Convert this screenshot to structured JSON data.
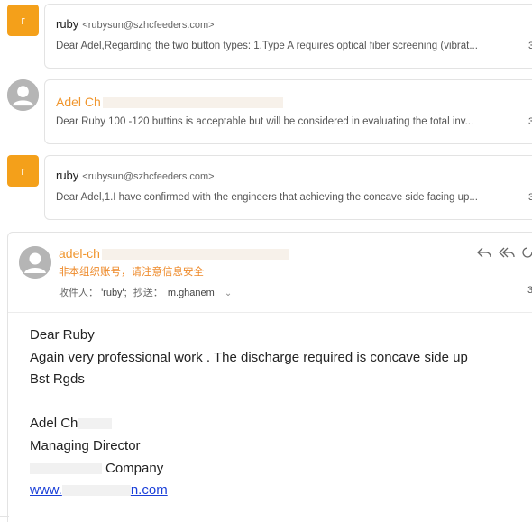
{
  "threads": [
    {
      "avatar_letter": "r",
      "sender": "ruby",
      "address": "<rubysun@szhcfeeders.com>",
      "snippet": "Dear Adel,Regarding the two button types: 1.Type A requires optical fiber screening (vibrat...",
      "time": "3"
    },
    {
      "sender": "Adel Ch",
      "snippet": "Dear Ruby 100 -120 buttins is acceptable but will be considered in evaluating the total inv...",
      "time": "3"
    },
    {
      "avatar_letter": "r",
      "sender": "ruby",
      "address": "<rubysun@szhcfeeders.com>",
      "snippet": "Dear Adel,1.I have confirmed with the engineers that achieving the concave side facing up...",
      "time": "3"
    }
  ],
  "expanded": {
    "sender": "adel-ch",
    "warning": "非本组织账号，请注意信息安全",
    "to_label": "收件人：",
    "to_value": "'ruby';",
    "cc_label": "抄送：",
    "cc_value": "m.ghanem",
    "time": "3",
    "body": {
      "greeting": "Dear Ruby",
      "line1": "Again very professional work . The discharge required is concave side up",
      "closing": "Bst Rgds",
      "name": "Adel Ch",
      "title": "Managing Director",
      "company": "Company",
      "link_prefix": "www.",
      "link_suffix": "n.com"
    }
  },
  "colors": {
    "accent_orange": "#f0962e",
    "avatar_orange": "#f4a01a",
    "link_blue": "#1a3fd8"
  }
}
